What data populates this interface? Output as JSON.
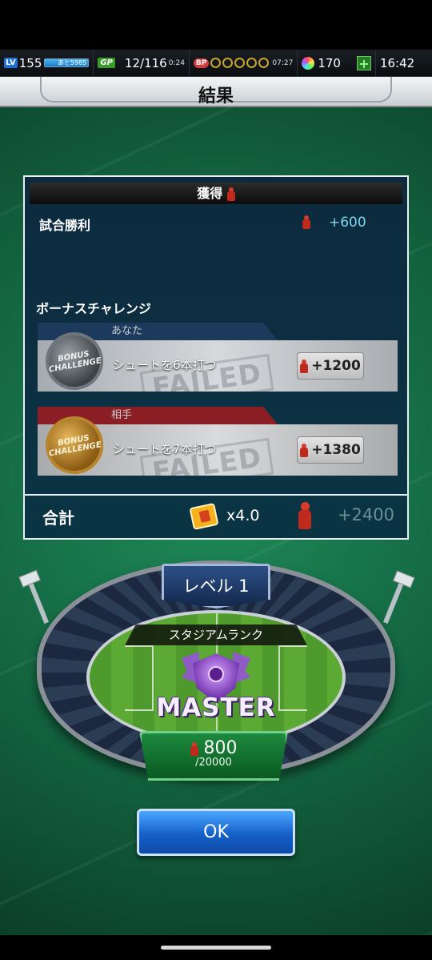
{
  "hud": {
    "level_badge": "LV",
    "level": "155",
    "xp_remaining": "あと5985",
    "gp_badge": "GP",
    "gp": "12/116",
    "gp_timer": "0:24",
    "bp_badge": "BP",
    "bp_timer": "07:27",
    "gems": "170",
    "add_label": "+",
    "clock": "16:42"
  },
  "header": {
    "title": "結果"
  },
  "result": {
    "earned_header": "獲得",
    "match_win_label": "試合勝利",
    "match_win_value": "+600",
    "bonus_title": "ボーナスチャレンジ",
    "challenges": [
      {
        "owner": "あなた",
        "medal_text": "BONUS CHALLENGE",
        "stamp": "FAILED",
        "task": "シュートを6本打つ",
        "reward": "+1200"
      },
      {
        "owner": "相手",
        "medal_text": "BONUS CHALLENGE",
        "stamp": "FAILED",
        "task": "シュートを7本打つ",
        "reward": "+1380"
      }
    ],
    "total_label": "合計",
    "multiplier": "x4.0",
    "total_value": "+2400"
  },
  "stadium": {
    "level": "レベル 1",
    "rank_label": "スタジアムランク",
    "rank_name": "MASTER",
    "points": "800",
    "points_max": "/20000"
  },
  "ok_label": "OK",
  "colors": {
    "panel_bg": "#0a3444",
    "value_blue": "#7fd6f0",
    "you_tab": "#1c3a5c",
    "opponent_tab": "#8a1e24",
    "ok_blue": "#1660c8"
  }
}
